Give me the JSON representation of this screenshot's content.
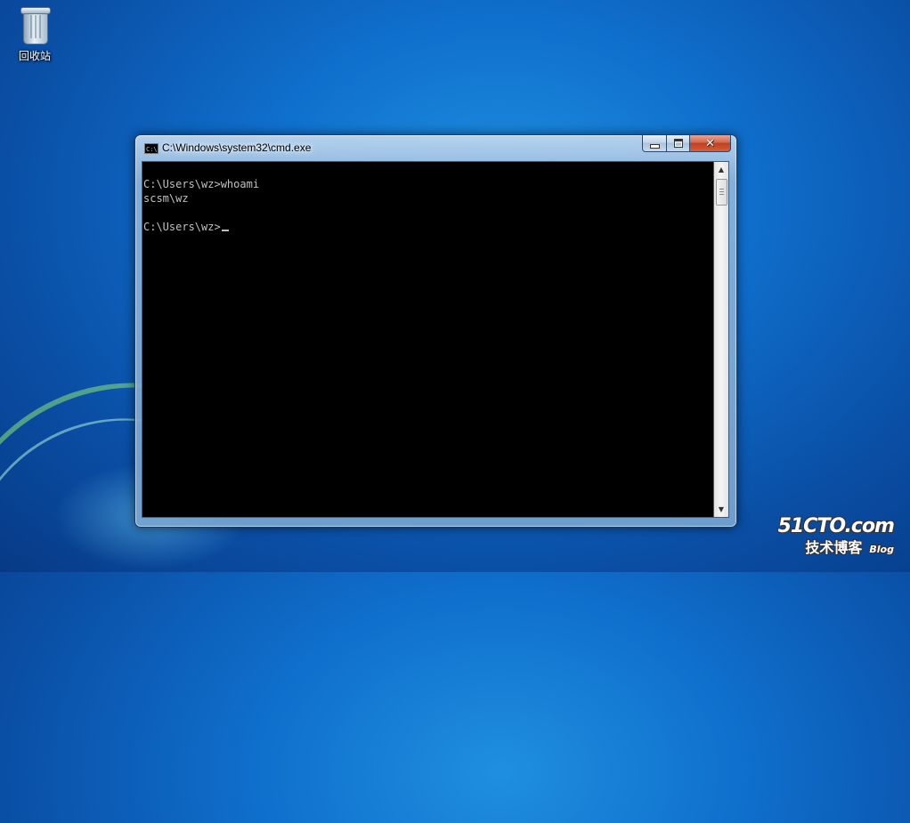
{
  "desktop": {
    "recycle_bin_label": "回收站"
  },
  "window": {
    "title": "C:\\Windows\\system32\\cmd.exe",
    "icon_text": "C:\\",
    "buttons": {
      "minimize": "minimize-icon",
      "maximize": "maximize-icon",
      "close": "close-icon"
    }
  },
  "console": {
    "lines": [
      "C:\\Users\\wz>whoami",
      "scsm\\wz",
      "",
      "C:\\Users\\wz>"
    ]
  },
  "watermark": {
    "line1": "51CTO.com",
    "line2": "技术博客",
    "blog": "Blog"
  },
  "colors": {
    "console_bg": "#000000",
    "console_fg": "#c0c0c0",
    "close_button": "#c0401f",
    "desktop_blue": "#0f6fcc"
  }
}
